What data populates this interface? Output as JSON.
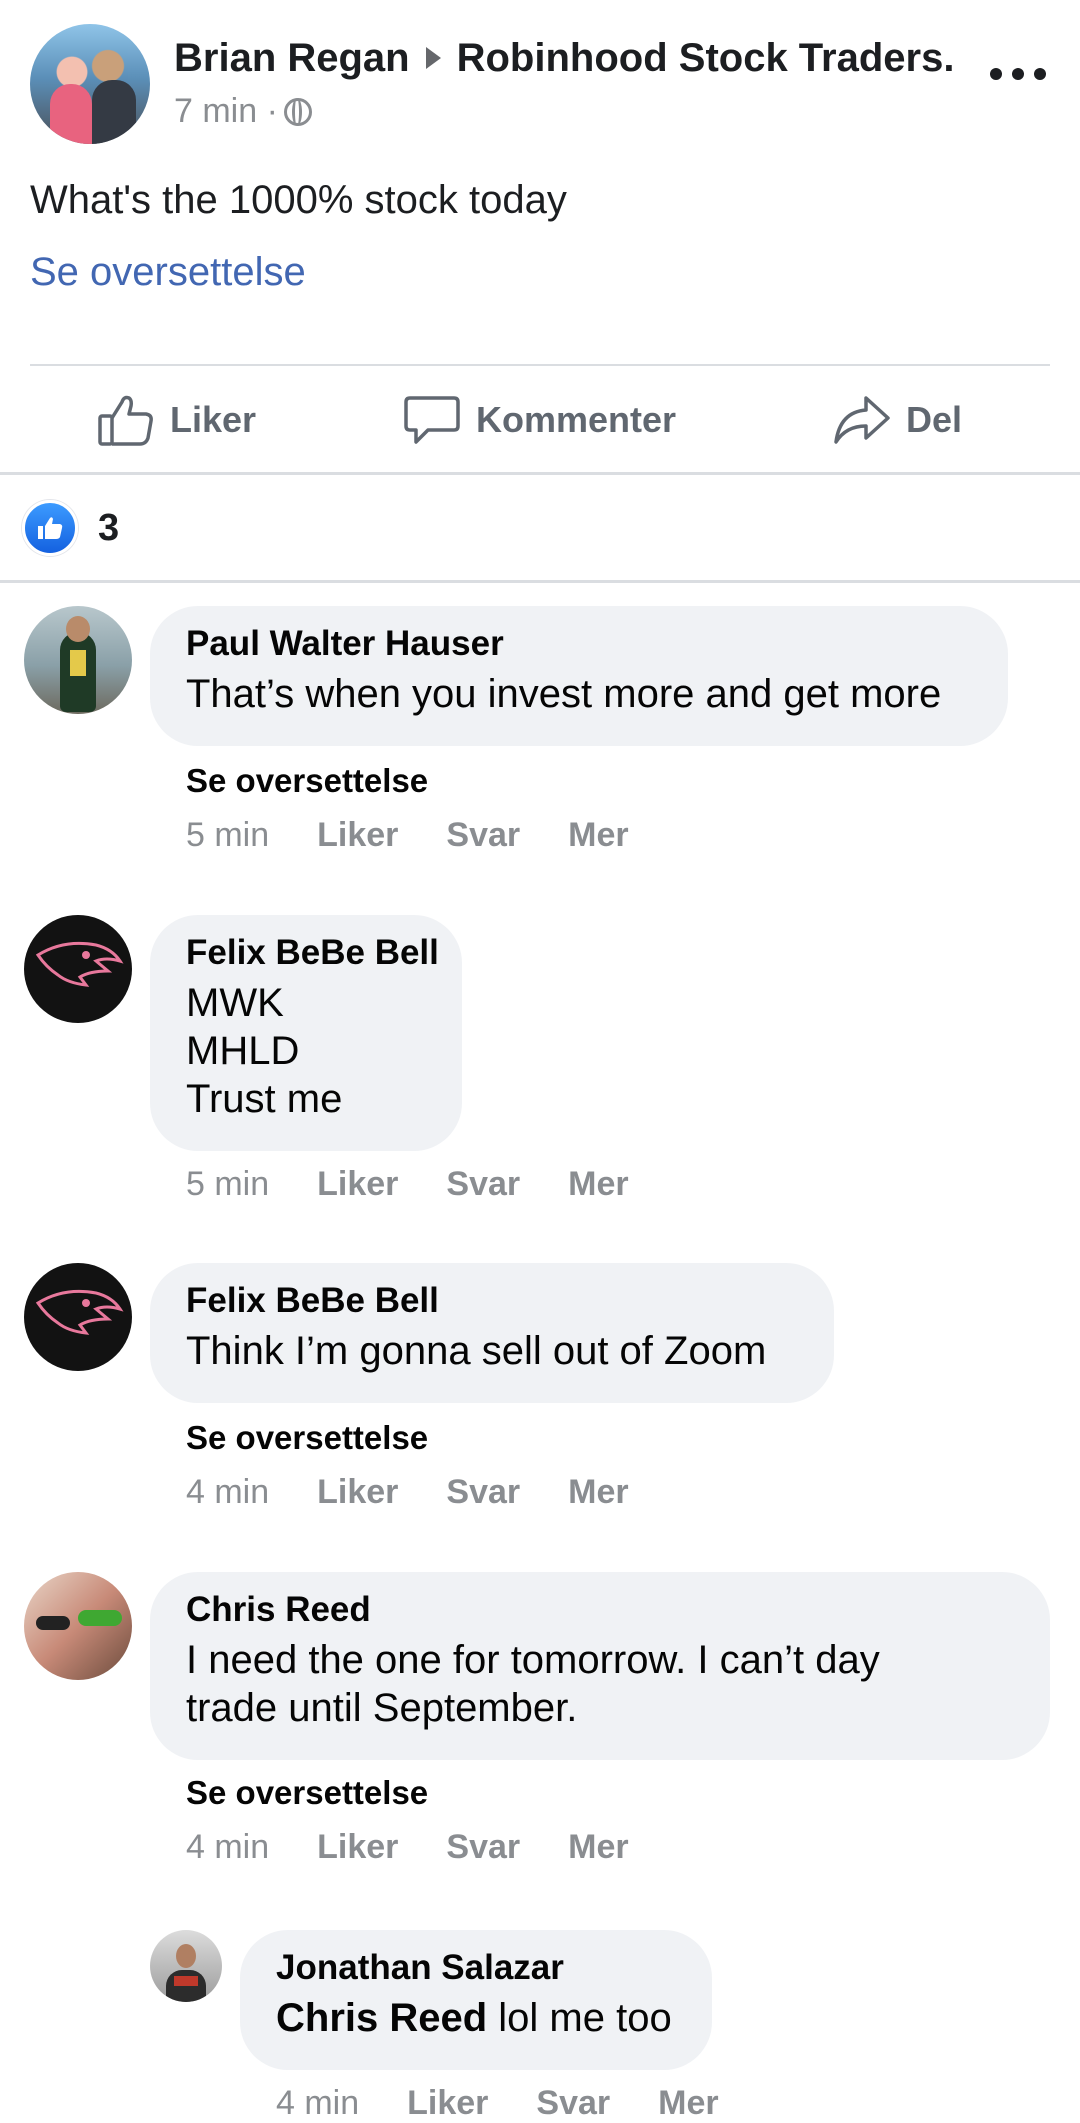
{
  "post": {
    "author": "Brian Regan",
    "group": "Robinhood Stock Traders.",
    "time": "7 min ·",
    "text": "What's the 1000% stock today",
    "translate": "Se oversettelse"
  },
  "actions": {
    "like": "Liker",
    "comment": "Kommenter",
    "share": "Del"
  },
  "reactions": {
    "count": "3",
    "icon": "thumbs-up"
  },
  "comments": [
    {
      "name": "Paul Walter Hauser",
      "text": "That’s when you invest more and get more",
      "translate": "Se oversettelse",
      "time": "5 min",
      "like": "Liker",
      "reply": "Svar",
      "more": "Mer"
    },
    {
      "name": "Felix BeBe Bell",
      "lines": [
        "MWK",
        "MHLD",
        "Trust me"
      ],
      "time": "5 min",
      "like": "Liker",
      "reply": "Svar",
      "more": "Mer"
    },
    {
      "name": "Felix BeBe Bell",
      "text": "Think I’m gonna sell out of Zoom",
      "translate": "Se oversettelse",
      "time": "4 min",
      "like": "Liker",
      "reply": "Svar",
      "more": "Mer"
    },
    {
      "name": "Chris Reed",
      "lines": [
        "I need the one for tomorrow. I can’t day",
        "trade until September."
      ],
      "translate": "Se oversettelse",
      "time": "4 min",
      "like": "Liker",
      "reply": "Svar",
      "more": "Mer"
    }
  ],
  "reply": {
    "name": "Jonathan Salazar",
    "mention": "Chris Reed",
    "text": " lol me too",
    "time": "4 min",
    "like": "Liker",
    "reply": "Svar",
    "more": "Mer"
  },
  "colors": {
    "link": "#4267b2",
    "bubble": "#f0f2f5",
    "like_blue": "#1877f2",
    "muted": "#8a8d91"
  }
}
